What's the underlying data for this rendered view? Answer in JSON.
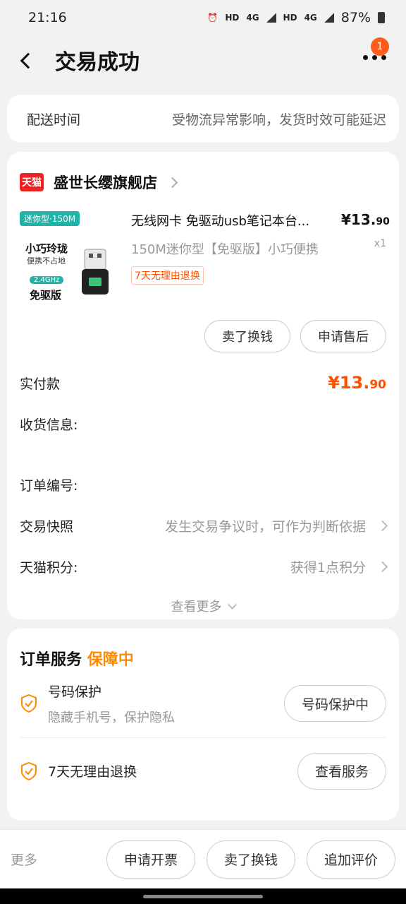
{
  "status_bar": {
    "time": "21:16",
    "net1": "HD",
    "net1b": "4G",
    "net2": "HD",
    "net2b": "4G",
    "battery": "87%"
  },
  "nav": {
    "title": "交易成功",
    "badge": "1"
  },
  "delivery": {
    "label": "配送时间",
    "value": "受物流异常影响，发货时效可能延迟"
  },
  "shop": {
    "logo": "天猫",
    "name": "盛世长缨旗舰店"
  },
  "product": {
    "thumb_tag": "迷你型·150M",
    "thumb_line1": "小巧玲珑",
    "thumb_line2": "便携不占地",
    "thumb_line3": "2.4GHz",
    "thumb_line4": "免驱版",
    "title": "无线网卡 免驱动usb笔记本台...",
    "spec": "150M迷你型【免驱版】小巧便携",
    "badge": "7天无理由退换",
    "price_int": "¥13.",
    "price_dec": "90",
    "qty": "x1"
  },
  "product_actions": {
    "sell": "卖了换钱",
    "after_sale": "申请售后"
  },
  "details": {
    "paid_label": "实付款",
    "paid_int": "¥13.",
    "paid_dec": "90",
    "address_label": "收货信息:",
    "order_no_label": "订单编号:",
    "snapshot_label": "交易快照",
    "snapshot_value": "发生交易争议时，可作为判断依据",
    "points_label": "天猫积分:",
    "points_value": "获得1点积分",
    "see_more": "查看更多"
  },
  "service": {
    "title": "订单服务",
    "status": "保障中",
    "items": [
      {
        "name": "号码保护",
        "desc": "隐藏手机号，保护隐私",
        "button": "号码保护中"
      },
      {
        "name": "7天无理由退换",
        "desc": "",
        "button": "查看服务"
      }
    ]
  },
  "bottom": {
    "more": "更多",
    "invoice": "申请开票",
    "sell": "卖了换钱",
    "review": "追加评价"
  },
  "colors": {
    "accent": "#ff5000",
    "guarantee": "#ff8a00",
    "tmall": "#ee2222"
  }
}
